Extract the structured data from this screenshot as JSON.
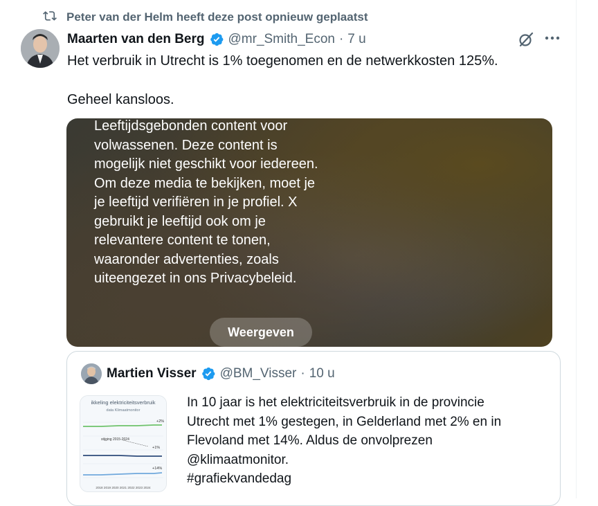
{
  "repost": {
    "icon": "repost-icon",
    "text": "Peter van der Helm heeft deze post opnieuw geplaatst"
  },
  "post": {
    "author": {
      "name": "Maarten van den Berg",
      "verified": true,
      "handle": "@mr_Smith_Econ",
      "separator": "·",
      "time": "7 u"
    },
    "text_line1": "Het verbruik in Utrecht is 1% toegenomen en de netwerkkosten 125%.",
    "text_line2": "Geheel kansloos.",
    "media": {
      "warning": "Leeftijdsgebonden content voor volwassenen. Deze content is mogelijk niet geschikt voor iedereen. Om deze media te bekijken, moet je je leeftijd verifiëren in je profiel. X gebruikt je leeftijd ook om je relevantere content te tonen, waaronder advertenties, zoals uiteengezet in ons Privacybeleid.",
      "button": "Weergeven"
    }
  },
  "quote": {
    "author": {
      "name": "Martien Visser",
      "verified": true,
      "handle": "@BM_Visser",
      "separator": "·",
      "time": "10 u"
    },
    "text_lines": [
      "In 10 jaar is het elektriciteitsverbruik in de provincie",
      "Utrecht met 1% gestegen, in Gelderland met 2% en in",
      "Flevoland met 14%. Aldus de onvolprezen",
      "@klimaatmonitor.",
      "#grafiekvandedag"
    ],
    "thumbnail": {
      "title": "ikkeling elektriciteitsverbruik",
      "subtitle": "data Klimaatmonitor",
      "annotation": "stijging 2015-2024",
      "labels": [
        "+2%",
        "+1%",
        "+14%"
      ],
      "years": "2018 2019 2020 2021 2022 2023 2024"
    }
  },
  "colors": {
    "text_primary": "#0f1419",
    "text_secondary": "#536471",
    "verified": "#1d9bf0",
    "border": "#cfd9de"
  }
}
